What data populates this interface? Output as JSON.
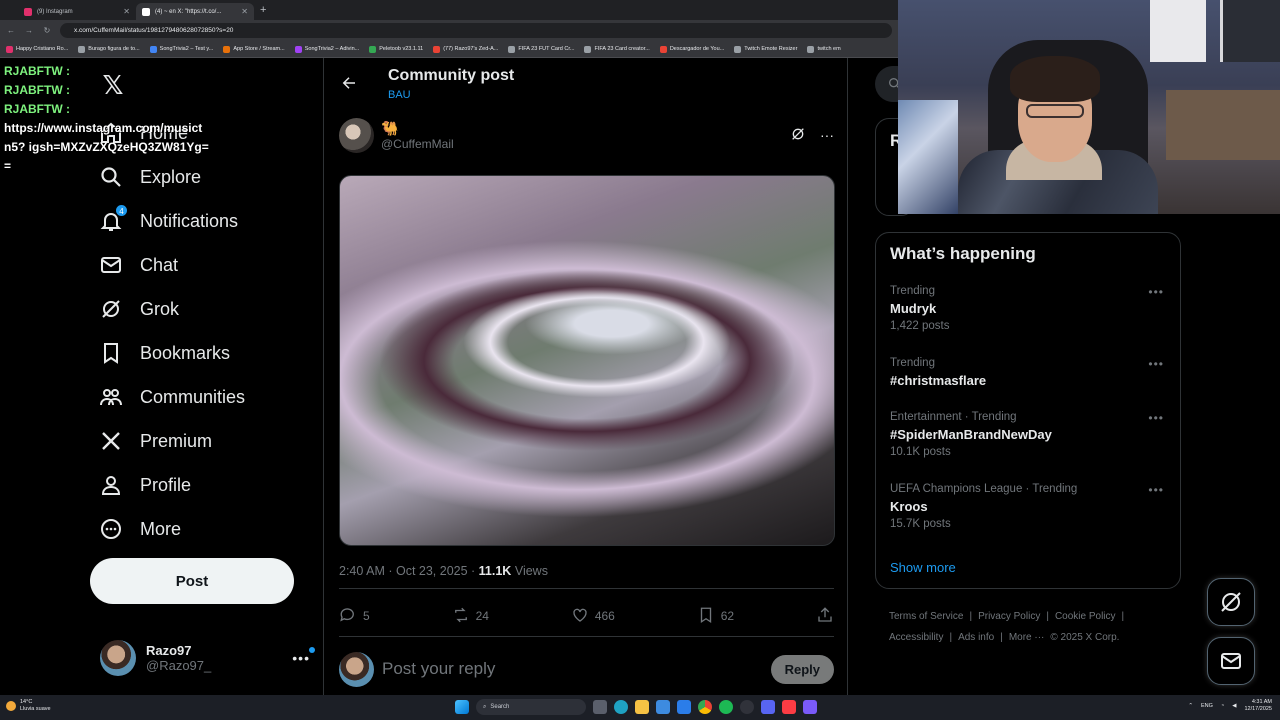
{
  "browser": {
    "tabs": [
      {
        "title": "(9) Instagram",
        "color": "#e1306c"
      },
      {
        "title": "(4) ~ en X: \"https://t.co/...",
        "color": "#ffffff"
      }
    ],
    "url": "x.com/CuffemMail/status/1981279480628072850?s=20",
    "bookmarks": [
      "Happy Cristiano Ro...",
      "Burago figura de to...",
      "SongTrivia2 – Test y...",
      "App Store / Stream...",
      "SongTrivia2 – Adivin...",
      "Peletoob v23.1.11",
      "(77) Razo97's Zed-A...",
      "FIFA 23 FUT Card Cr...",
      "FIFA 23 Card creator...",
      "Descargador de You...",
      "Twitch Emote Resizer",
      "twitch em"
    ]
  },
  "chat_overlay": {
    "lines": [
      {
        "user": "RJABFTW :",
        "message": ""
      },
      {
        "user": "RJABFTW :",
        "message": ""
      },
      {
        "user": "RJABFTW :",
        "message": ""
      }
    ],
    "link_text": "https://www.instagram.com/musict n5? igsh=MXZvZXQzeHQ3ZW81Yg=="
  },
  "nav": {
    "items": [
      {
        "label": "Home",
        "icon": "home-icon"
      },
      {
        "label": "Explore",
        "icon": "search-icon"
      },
      {
        "label": "Notifications",
        "icon": "bell-icon",
        "badge": "4"
      },
      {
        "label": "Chat",
        "icon": "mail-icon"
      },
      {
        "label": "Grok",
        "icon": "grok-icon"
      },
      {
        "label": "Bookmarks",
        "icon": "bookmark-icon"
      },
      {
        "label": "Communities",
        "icon": "communities-icon"
      },
      {
        "label": "Premium",
        "icon": "x-logo-icon"
      },
      {
        "label": "Profile",
        "icon": "person-icon"
      },
      {
        "label": "More",
        "icon": "more-circle-icon"
      }
    ],
    "post_button": "Post",
    "account": {
      "name": "Razo97",
      "handle": "@Razo97_"
    }
  },
  "post": {
    "header_title": "Community post",
    "header_subtitle": "BAU",
    "author_name": "🐫",
    "author_handle": "@CuffemMail",
    "time": "2:40 AM · Oct 23, 2025 ·",
    "views_count": "11.1K",
    "views_label": "Views",
    "stats": {
      "replies": "5",
      "reposts": "24",
      "likes": "466",
      "bookmarks": "62"
    },
    "reply_placeholder": "Post your reply",
    "reply_button": "Reply"
  },
  "sidebar": {
    "card_stub_letter": "R",
    "whats_happening_title": "What’s happening",
    "trends": [
      {
        "context": "Trending",
        "name": "Mudryk",
        "count": "1,422 posts"
      },
      {
        "context": "Trending",
        "name": "#christmasflare",
        "count": ""
      },
      {
        "context": "Entertainment · Trending",
        "name": "#SpiderManBrandNewDay",
        "count": "10.1K posts"
      },
      {
        "context": "UEFA Champions League · Trending",
        "name": "Kroos",
        "count": "15.7K posts"
      }
    ],
    "show_more": "Show more",
    "footer": {
      "line1": [
        "Terms of Service",
        "|",
        "Privacy Policy",
        "|",
        "Cookie Policy",
        "|"
      ],
      "line2": [
        "Accessibility",
        "|",
        "Ads info",
        "|",
        "More ···",
        "© 2025 X Corp."
      ]
    }
  },
  "taskbar": {
    "weather_temp": "14°C",
    "weather_desc": "Lluvia suave",
    "search_label": "Search",
    "lang": "ENG",
    "time": "4:31 AM",
    "date": "12/17/2025"
  },
  "colors": {
    "accent": "#1d9bf0",
    "background": "#000000",
    "chat_user": "#7ef27e"
  }
}
